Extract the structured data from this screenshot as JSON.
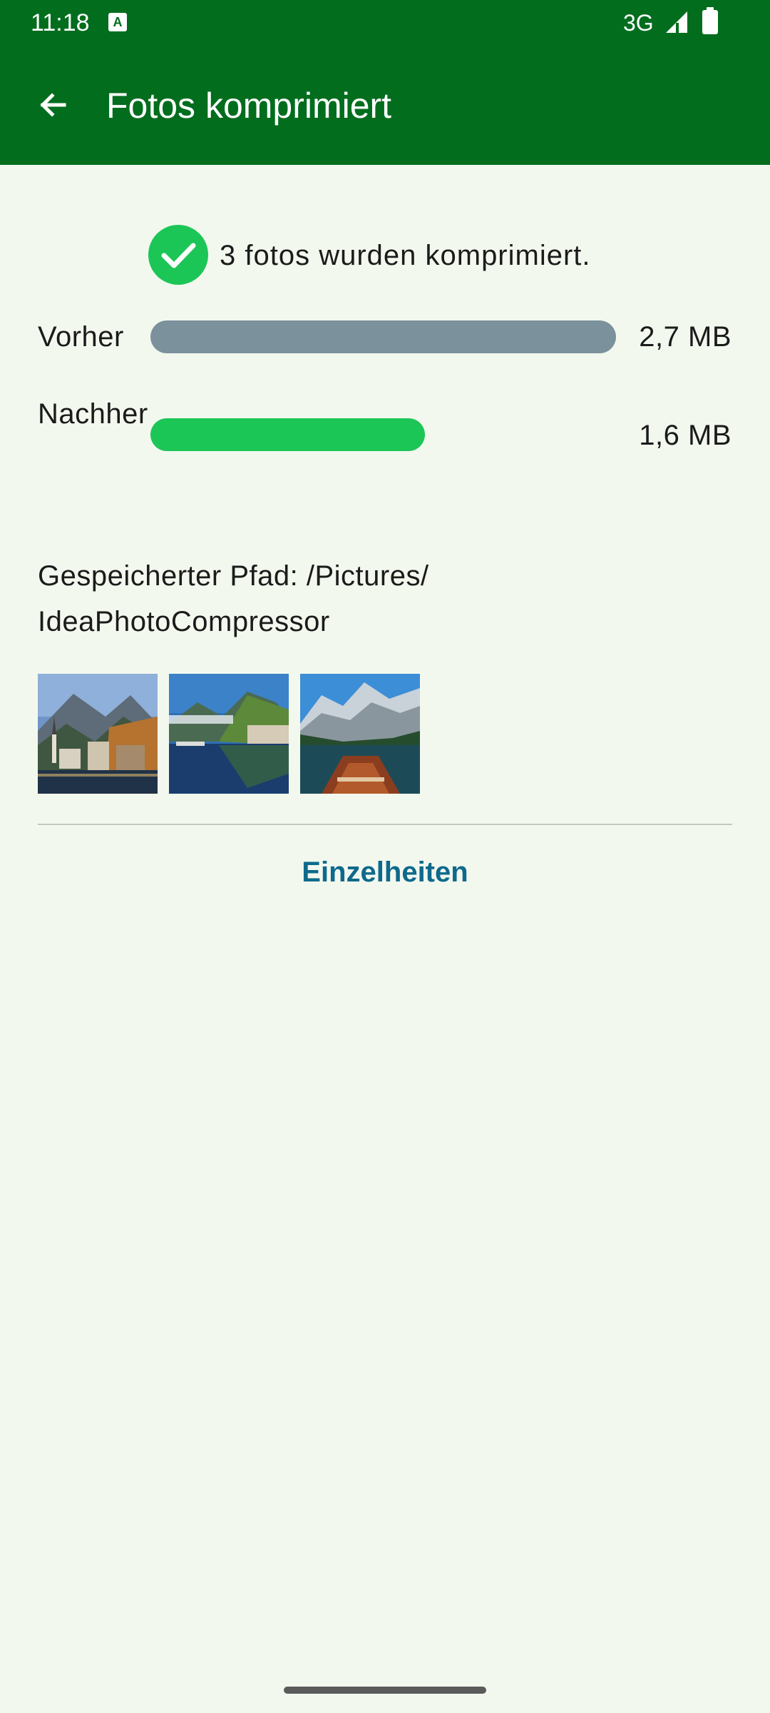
{
  "status_bar": {
    "time": "11:18",
    "notification_icon": "A",
    "network": "3G",
    "icons": [
      "signal-icon",
      "battery-icon"
    ]
  },
  "app_bar": {
    "back_icon": "arrow-left-icon",
    "title": "Fotos komprimiert"
  },
  "result": {
    "icon": "check-circle-icon",
    "message": "3 fotos wurden komprimiert."
  },
  "comparison": {
    "before": {
      "label": "Vorher",
      "size": "2,7 MB",
      "fraction": 1.0,
      "color": "#7b919c"
    },
    "after": {
      "label": "Nachher",
      "size": "1,6 MB",
      "fraction": 0.59,
      "color": "#1cc656"
    }
  },
  "saved_path": "Gespeicherter Pfad: /Pictures/ IdeaPhotoCompressor",
  "thumbnails": [
    "lakeside-village-photo",
    "mountain-lake-reflection-photo",
    "boat-mountain-lake-photo"
  ],
  "details_button": "Einzelheiten",
  "colors": {
    "app_bar": "#016d1d",
    "background": "#f3f8ef",
    "accent_green": "#1cc656",
    "link": "#0e6a8c"
  }
}
